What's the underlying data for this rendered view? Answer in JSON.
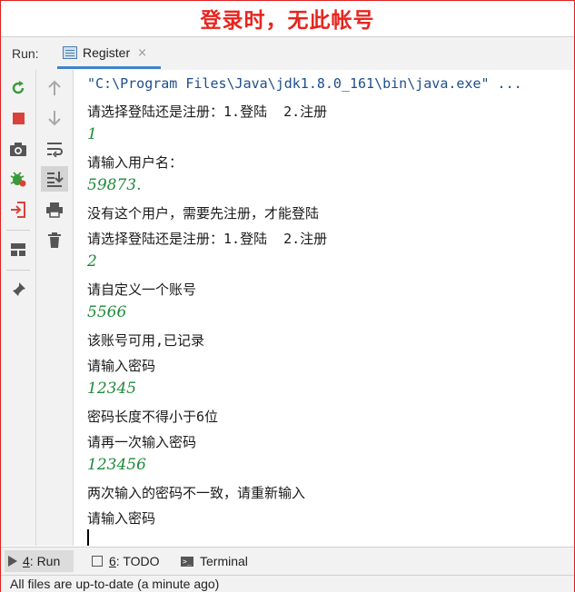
{
  "banner": {
    "text": "登录时，无此帐号",
    "color": "#e8251e"
  },
  "run_panel": {
    "label": "Run:",
    "tab": {
      "label": "Register",
      "close": "×"
    }
  },
  "left_toolbar": {
    "icons": [
      "rerun-icon",
      "stop-icon",
      "camera-icon",
      "debug-bug-icon",
      "login-exit-icon",
      "layout-icon",
      "pin-icon"
    ]
  },
  "second_toolbar": {
    "icons": [
      "arrow-up-icon",
      "arrow-down-icon",
      "soft-wrap-icon",
      "scroll-to-end-icon",
      "print-icon",
      "trash-icon"
    ]
  },
  "console": {
    "lines": [
      {
        "text": "\"C:\\Program Files\\Java\\jdk1.8.0_161\\bin\\java.exe\" ...",
        "kind": "cmd"
      },
      {
        "text": "请选择登陆还是注册：1.登陆  2.注册",
        "kind": "out"
      },
      {
        "text": "1",
        "kind": "user"
      },
      {
        "text": "请输入用户名：",
        "kind": "out"
      },
      {
        "text": "59873.",
        "kind": "user"
      },
      {
        "text": "没有这个用户，需要先注册，才能登陆",
        "kind": "out"
      },
      {
        "text": "请选择登陆还是注册：1.登陆  2.注册",
        "kind": "out"
      },
      {
        "text": "2",
        "kind": "user"
      },
      {
        "text": "请自定义一个账号",
        "kind": "out"
      },
      {
        "text": "5566",
        "kind": "user"
      },
      {
        "text": "该账号可用,已记录",
        "kind": "out"
      },
      {
        "text": "请输入密码",
        "kind": "out"
      },
      {
        "text": "12345",
        "kind": "user"
      },
      {
        "text": "密码长度不得小于6位",
        "kind": "out"
      },
      {
        "text": "请再一次输入密码",
        "kind": "out"
      },
      {
        "text": "123456",
        "kind": "user"
      },
      {
        "text": "两次输入的密码不一致，请重新输入",
        "kind": "out"
      },
      {
        "text": "请输入密码",
        "kind": "out"
      }
    ]
  },
  "bottom_tabs": [
    {
      "number": "4",
      "label": ": Run",
      "icon": "run-icon",
      "active": true
    },
    {
      "number": "6",
      "label": ": TODO",
      "icon": "todo-icon",
      "active": false
    },
    {
      "number": "",
      "label": "Terminal",
      "icon": "terminal-icon",
      "active": false
    }
  ],
  "status": {
    "text": "All files are up-to-date (a minute ago)"
  }
}
